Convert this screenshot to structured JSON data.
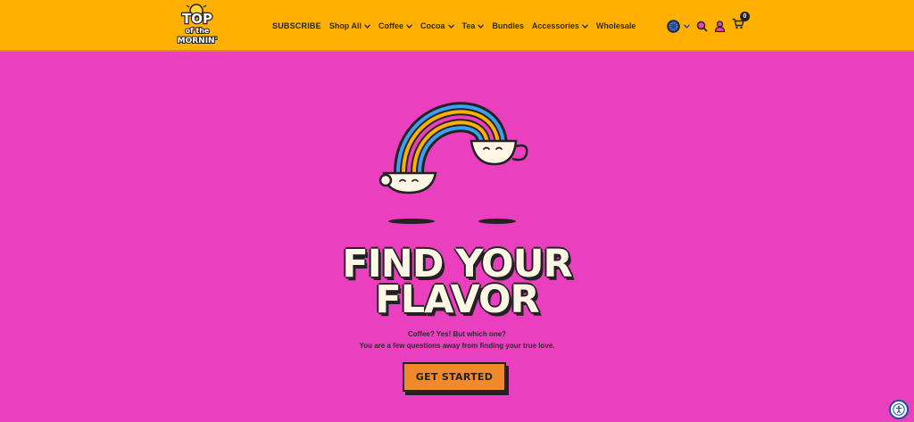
{
  "header": {
    "logo_alt": "Top of the Mornin'",
    "nav": [
      {
        "label": "SUBSCRIBE",
        "dropdown": false
      },
      {
        "label": "Shop All",
        "dropdown": true
      },
      {
        "label": "Coffee",
        "dropdown": true
      },
      {
        "label": "Cocoa",
        "dropdown": true
      },
      {
        "label": "Tea",
        "dropdown": true
      },
      {
        "label": "Bundles",
        "dropdown": false
      },
      {
        "label": "Accessories",
        "dropdown": true
      },
      {
        "label": "Wholesale",
        "dropdown": false
      }
    ],
    "cart_count": "0",
    "icons": [
      "globe-icon",
      "chevron-down-icon",
      "search-icon",
      "account-icon",
      "cart-icon"
    ]
  },
  "hero": {
    "title_line1": "FIND YOUR",
    "title_line2": "FLAVOR",
    "subtitle_line1": "Coffee? Yes! But which one?",
    "subtitle_line2": "You are a few questions away from finding your true love.",
    "cta_label": "GET STARTED"
  },
  "colors": {
    "header_bg": "#ffb000",
    "hero_bg": "#ea3fbf",
    "cta_bg": "#f08a2b",
    "rainbow": [
      "#3aa0f0",
      "#ffb000",
      "#ea3fbf"
    ]
  }
}
